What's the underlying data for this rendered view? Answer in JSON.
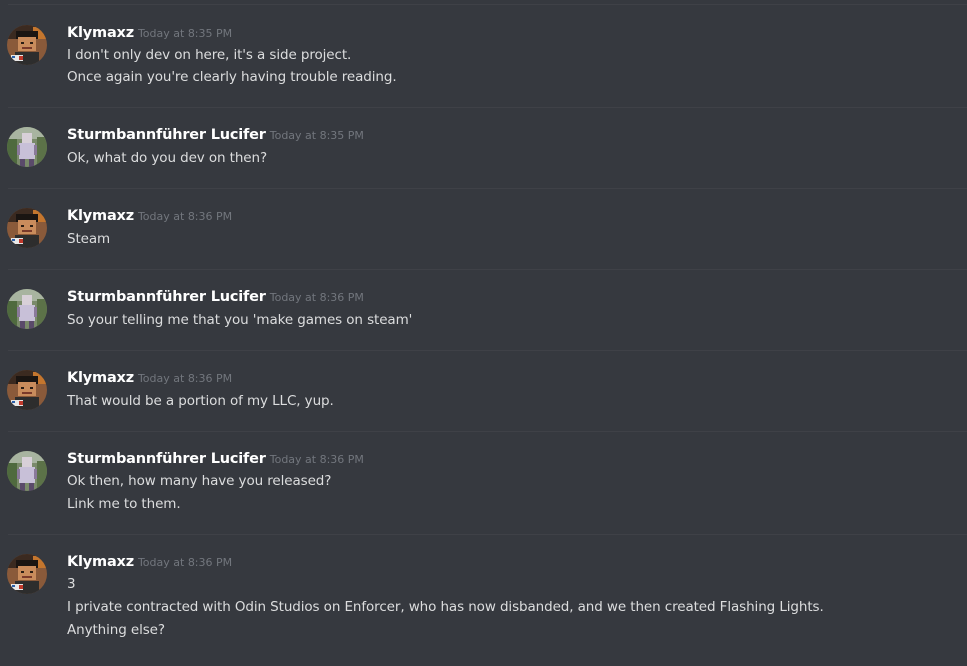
{
  "messages": [
    {
      "author": "Klymaxz",
      "avatar_icon": "klymaxz-avatar-icon",
      "timestamp": "Today at 8:35 PM",
      "lines": [
        "I don't only dev on here, it's a side project.",
        "Once again you're clearly having trouble reading."
      ]
    },
    {
      "author": "Sturmbannführer Lucifer",
      "avatar_icon": "lucifer-avatar-icon",
      "timestamp": "Today at 8:35 PM",
      "lines": [
        "Ok, what do you dev on then?"
      ]
    },
    {
      "author": "Klymaxz",
      "avatar_icon": "klymaxz-avatar-icon",
      "timestamp": "Today at 8:36 PM",
      "lines": [
        "Steam"
      ]
    },
    {
      "author": "Sturmbannführer Lucifer",
      "avatar_icon": "lucifer-avatar-icon",
      "timestamp": "Today at 8:36 PM",
      "lines": [
        "So your telling me that you 'make games on steam'"
      ]
    },
    {
      "author": "Klymaxz",
      "avatar_icon": "klymaxz-avatar-icon",
      "timestamp": "Today at 8:36 PM",
      "lines": [
        "That would be a portion of my LLC, yup."
      ]
    },
    {
      "author": "Sturmbannführer Lucifer",
      "avatar_icon": "lucifer-avatar-icon",
      "timestamp": "Today at 8:36 PM",
      "lines": [
        "Ok then, how many have you released?",
        "Link me to them."
      ]
    },
    {
      "author": "Klymaxz",
      "avatar_icon": "klymaxz-avatar-icon",
      "timestamp": "Today at 8:36 PM",
      "lines": [
        "3",
        "I private contracted with Odin Studios on Enforcer, who has now disbanded, and we then created Flashing Lights.",
        "Anything else?"
      ]
    }
  ],
  "colors": {
    "background": "#36393f",
    "username": "#ffffff",
    "timestamp": "#72767d",
    "text": "#dcddde",
    "divider": "#3f4147"
  }
}
